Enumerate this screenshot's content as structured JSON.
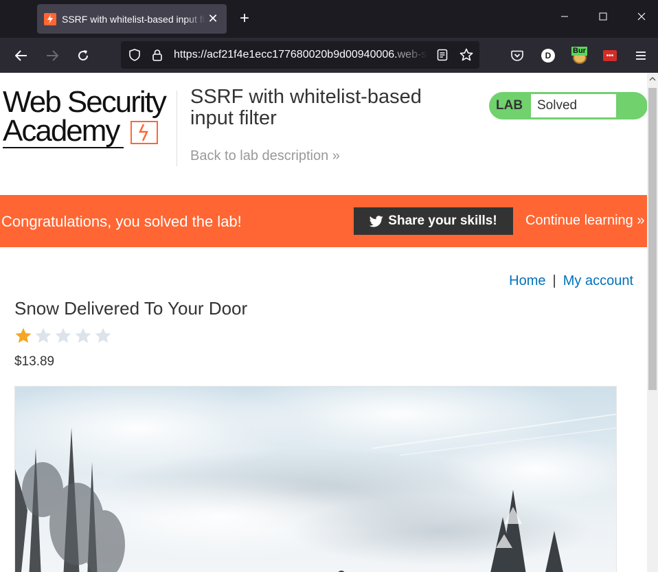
{
  "browser": {
    "tab_title": "SSRF with whitelist-based input filter",
    "tab_close_glyph": "✕",
    "new_tab_glyph": "+",
    "url_host": "https://acf21f4e1ecc177680020b9d00940006.",
    "url_rest": "web-security-academy.net",
    "profile_initial": "D",
    "burp_label": "Bur",
    "lastpass_label": "•••"
  },
  "header": {
    "logo_line1": "Web Security",
    "logo_line2": "Academy",
    "lab_title": "SSRF with whitelist-based input filter",
    "back_link": "Back to lab description »",
    "lab_badge_label": "LAB",
    "lab_status": "Solved"
  },
  "banner": {
    "message": "Congratulations, you solved the lab!",
    "share_label": "Share your skills!",
    "continue_label": "Continue learning »"
  },
  "nav": {
    "home": "Home",
    "separator": "|",
    "my_account": "My account"
  },
  "product": {
    "title": "Snow Delivered To Your Door",
    "rating": 1,
    "rating_max": 5,
    "price": "$13.89"
  },
  "colors": {
    "accent": "#ff6633",
    "solved_green": "#70d16d",
    "link_blue": "#0071bc",
    "star_filled": "#f5a623",
    "star_empty": "#dde3ea"
  }
}
